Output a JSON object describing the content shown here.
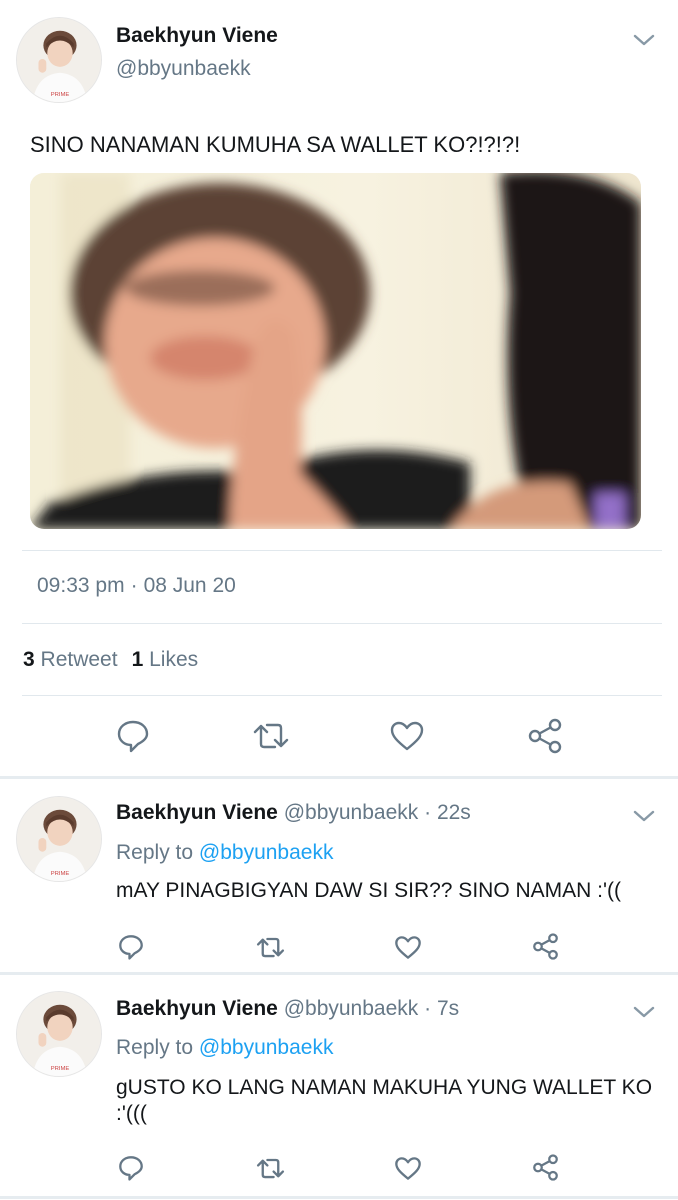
{
  "main_tweet": {
    "author_name": "Baekhyun Viene",
    "author_handle": "@bbyunbaekk",
    "text": "SINO NANAMAN KUMUHA SA WALLET KO?!?!?!",
    "time": "09:33 pm",
    "separator": "·",
    "date": "08 Jun 20",
    "retweet_count": "3",
    "retweet_label": "Retweet",
    "like_count": "1",
    "like_label": "Likes",
    "avatar_caption": "PRIME"
  },
  "replies": [
    {
      "author_name": "Baekhyun Viene",
      "author_handle": "@bbyunbaekk",
      "time_ago": "· 22s",
      "reply_to_label": "Reply to",
      "reply_to_handle": "@bbyunbaekk",
      "text": "mAY PINAGBIGYAN DAW SI SIR?? SINO NAMAN :'((",
      "avatar_caption": "PRIME"
    },
    {
      "author_name": "Baekhyun Viene",
      "author_handle": "@bbyunbaekk",
      "time_ago": "· 7s",
      "reply_to_label": "Reply to",
      "reply_to_handle": "@bbyunbaekk",
      "text": "gUSTO KO LANG NAMAN MAKUHA YUNG WALLET KO :'(((",
      "avatar_caption": "PRIME"
    }
  ],
  "icons": {
    "reply": "reply-icon",
    "retweet": "retweet-icon",
    "like": "heart-icon",
    "share": "share-icon",
    "menu": "chevron-down-icon"
  },
  "colors": {
    "text": "#14171a",
    "muted": "#657786",
    "link": "#1da1f2",
    "divider": "#e1e8ed"
  }
}
